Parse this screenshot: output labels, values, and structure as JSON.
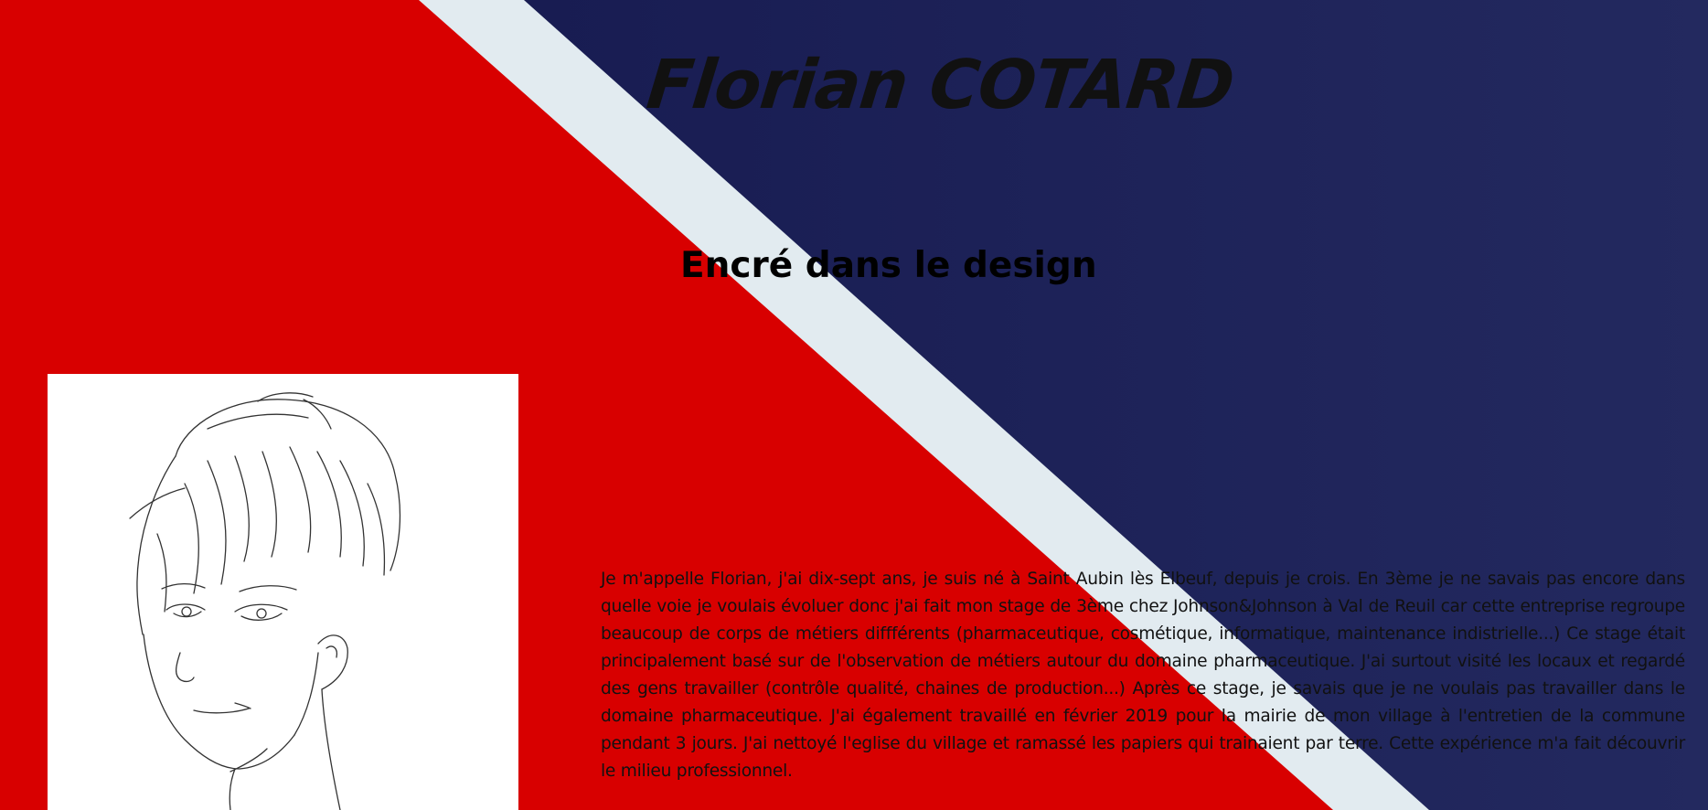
{
  "header": {
    "name": "Florian COTARD",
    "tagline": "Encré dans le design"
  },
  "about": {
    "portrait_alt": "Dessin au trait d'un jeune homme",
    "text": "Je m'appelle Florian, j'ai dix-sept ans, je suis né à Saint Aubin lès Elbeuf, depuis je crois. En 3ème je ne savais pas encore dans quelle voie je voulais évoluer donc j'ai fait mon stage de 3ème chez Johnson&Johnson à Val de Reuil car cette entreprise regroupe beaucoup de corps de métiers diffférents (pharmaceutique, cosmétique, informatique, maintenance indistrielle...) Ce stage était principalement basé sur de l'observation de métiers autour du domaine pharmaceutique. J'ai surtout visité les locaux et regardé des gens travailler (contrôle qualité, chaines de production...) Après ce stage, je savais que je ne voulais pas travailler dans le domaine pharmaceutique. J'ai également travaillé en février 2019 pour la mairie de mon village à l'entretien de la commune pendant 3 jours. J'ai nettoyé l'eglise du village et ramassé les papiers qui trainaient par terre. Cette expérience m'a fait découvrir le milieu professionnel."
  },
  "colors": {
    "red": "#d80000",
    "navy": "#1d2258",
    "stripe": "#e2ebf0",
    "text": "#111111"
  }
}
